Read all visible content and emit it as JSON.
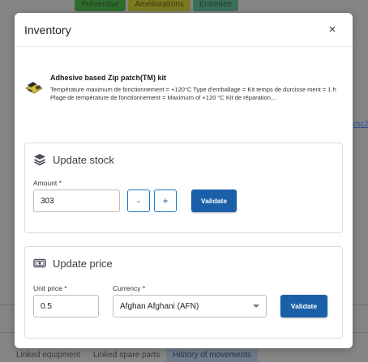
{
  "background": {
    "top_tabs": [
      "Préventive",
      "Améliorations",
      "Entretien"
    ],
    "link_text": "mc2",
    "bottom_tabs": [
      "Linked equipment",
      "Linked spare parts",
      "History of movements"
    ]
  },
  "modal": {
    "title": "Inventory",
    "close_icon": "×"
  },
  "product": {
    "icon": "adhesive-patch-kit-icon",
    "name": "Adhesive based Zip patch(TM) kit",
    "description": "Température maximum de fonctionnement = +120°C Type d'emballage = Kit temps de durcisse ment = 1 h Plage de température de fonctionnement = Maximum of +120 °C Kit de réparation..."
  },
  "stock": {
    "title": "Update stock",
    "icon": "layers-icon",
    "amount_label": "Amount *",
    "amount_value": "303",
    "decrement_label": "-",
    "increment_label": "+",
    "validate_label": "Validate"
  },
  "price": {
    "title": "Update price",
    "icon": "money-icon",
    "unit_price_label": "Unit price *",
    "unit_price_value": "0.5",
    "currency_label": "Currency *",
    "currency_value": "Afghan Afghani (AFN)",
    "validate_label": "Validate"
  },
  "colors": {
    "primary": "#1a5fa8",
    "overlay": "#858585"
  }
}
